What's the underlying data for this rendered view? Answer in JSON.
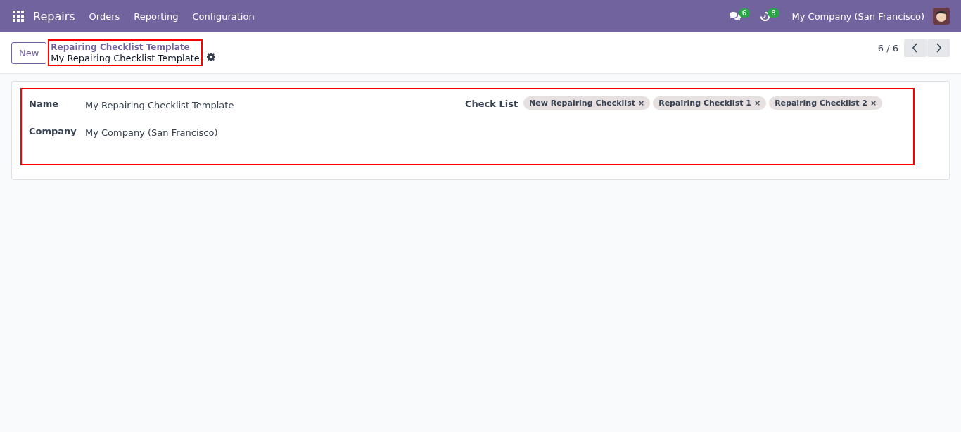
{
  "navbar": {
    "app": "Repairs",
    "menu": [
      "Orders",
      "Reporting",
      "Configuration"
    ],
    "messages_count": "6",
    "activities_count": "8",
    "company": "My Company (San Francisco)"
  },
  "control_panel": {
    "new_button": "New",
    "breadcrumb_parent": "Repairing Checklist Template",
    "breadcrumb_current": "My Repairing Checklist Template",
    "pager": "6 / 6"
  },
  "form": {
    "fields": [
      {
        "label": "Name",
        "value": "My Repairing Checklist Template"
      },
      {
        "label": "Company",
        "value": "My Company (San Francisco)"
      }
    ],
    "check_list": {
      "label": "Check List",
      "tags": [
        {
          "label": "New Repairing Checklist",
          "remove": "×"
        },
        {
          "label": "Repairing Checklist 1",
          "remove": "×"
        },
        {
          "label": "Repairing Checklist 2",
          "remove": "×"
        }
      ]
    }
  }
}
